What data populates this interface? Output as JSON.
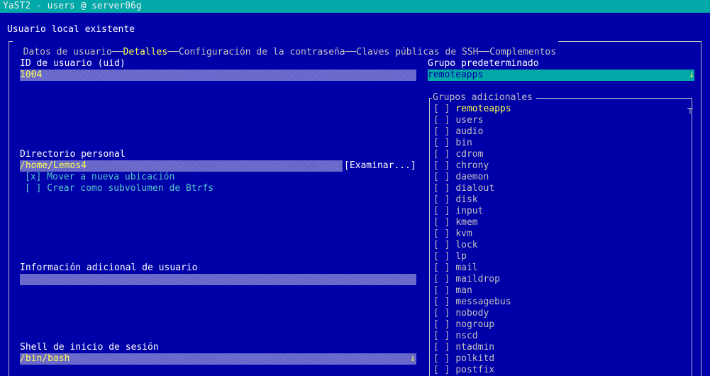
{
  "window": {
    "title": "YaST2 - users @ server06g"
  },
  "dialog": {
    "title": "Usuario local existente"
  },
  "tabs": [
    {
      "label": "Datos de usuario"
    },
    {
      "label": "Detalles"
    },
    {
      "label": "Configuración de la contraseña"
    },
    {
      "label": "Claves públicas de SSH"
    },
    {
      "label": "Complementos"
    }
  ],
  "uid": {
    "label": "ID de usuario (uid)",
    "value": "1004"
  },
  "home": {
    "label": "Directorio personal",
    "value": "/home/Lemos4",
    "browse_label": "[Examinar...]",
    "move_checkbox": "[x] Mover a nueva ubicación",
    "btrfs_checkbox": "[ ] Crear como subvolumen de Btrfs"
  },
  "info": {
    "label": "Información adicional de usuario",
    "value": ""
  },
  "shell": {
    "label": "Shell de inicio de sesión",
    "value": "/bin/bash"
  },
  "default_group": {
    "label": "Grupo predeterminado",
    "value": "remoteapps"
  },
  "additional_groups": {
    "label": "Grupos adicionales",
    "items": [
      {
        "check": "[ ]",
        "name": "remoteapps"
      },
      {
        "check": "[ ]",
        "name": "users"
      },
      {
        "check": "[ ]",
        "name": "audio"
      },
      {
        "check": "[ ]",
        "name": "bin"
      },
      {
        "check": "[ ]",
        "name": "cdrom"
      },
      {
        "check": "[ ]",
        "name": "chrony"
      },
      {
        "check": "[ ]",
        "name": "daemon"
      },
      {
        "check": "[ ]",
        "name": "dialout"
      },
      {
        "check": "[ ]",
        "name": "disk"
      },
      {
        "check": "[ ]",
        "name": "input"
      },
      {
        "check": "[ ]",
        "name": "kmem"
      },
      {
        "check": "[ ]",
        "name": "kvm"
      },
      {
        "check": "[ ]",
        "name": "lock"
      },
      {
        "check": "[ ]",
        "name": "lp"
      },
      {
        "check": "[ ]",
        "name": "mail"
      },
      {
        "check": "[ ]",
        "name": "maildrop"
      },
      {
        "check": "[ ]",
        "name": "man"
      },
      {
        "check": "[ ]",
        "name": "messagebus"
      },
      {
        "check": "[ ]",
        "name": "nobody"
      },
      {
        "check": "[ ]",
        "name": "nogroup"
      },
      {
        "check": "[ ]",
        "name": "nscd"
      },
      {
        "check": "[ ]",
        "name": "ntadmin"
      },
      {
        "check": "[ ]",
        "name": "polkitd"
      },
      {
        "check": "[ ]",
        "name": "postfix"
      }
    ]
  },
  "icons": {
    "dropdown": "down-arrow-icon",
    "scrollbar": "scroll-icon"
  },
  "colors": {
    "background": "#0000a8",
    "titlebar": "#00a8a8",
    "highlight": "#ffff54",
    "text": "#c0c0c0"
  }
}
